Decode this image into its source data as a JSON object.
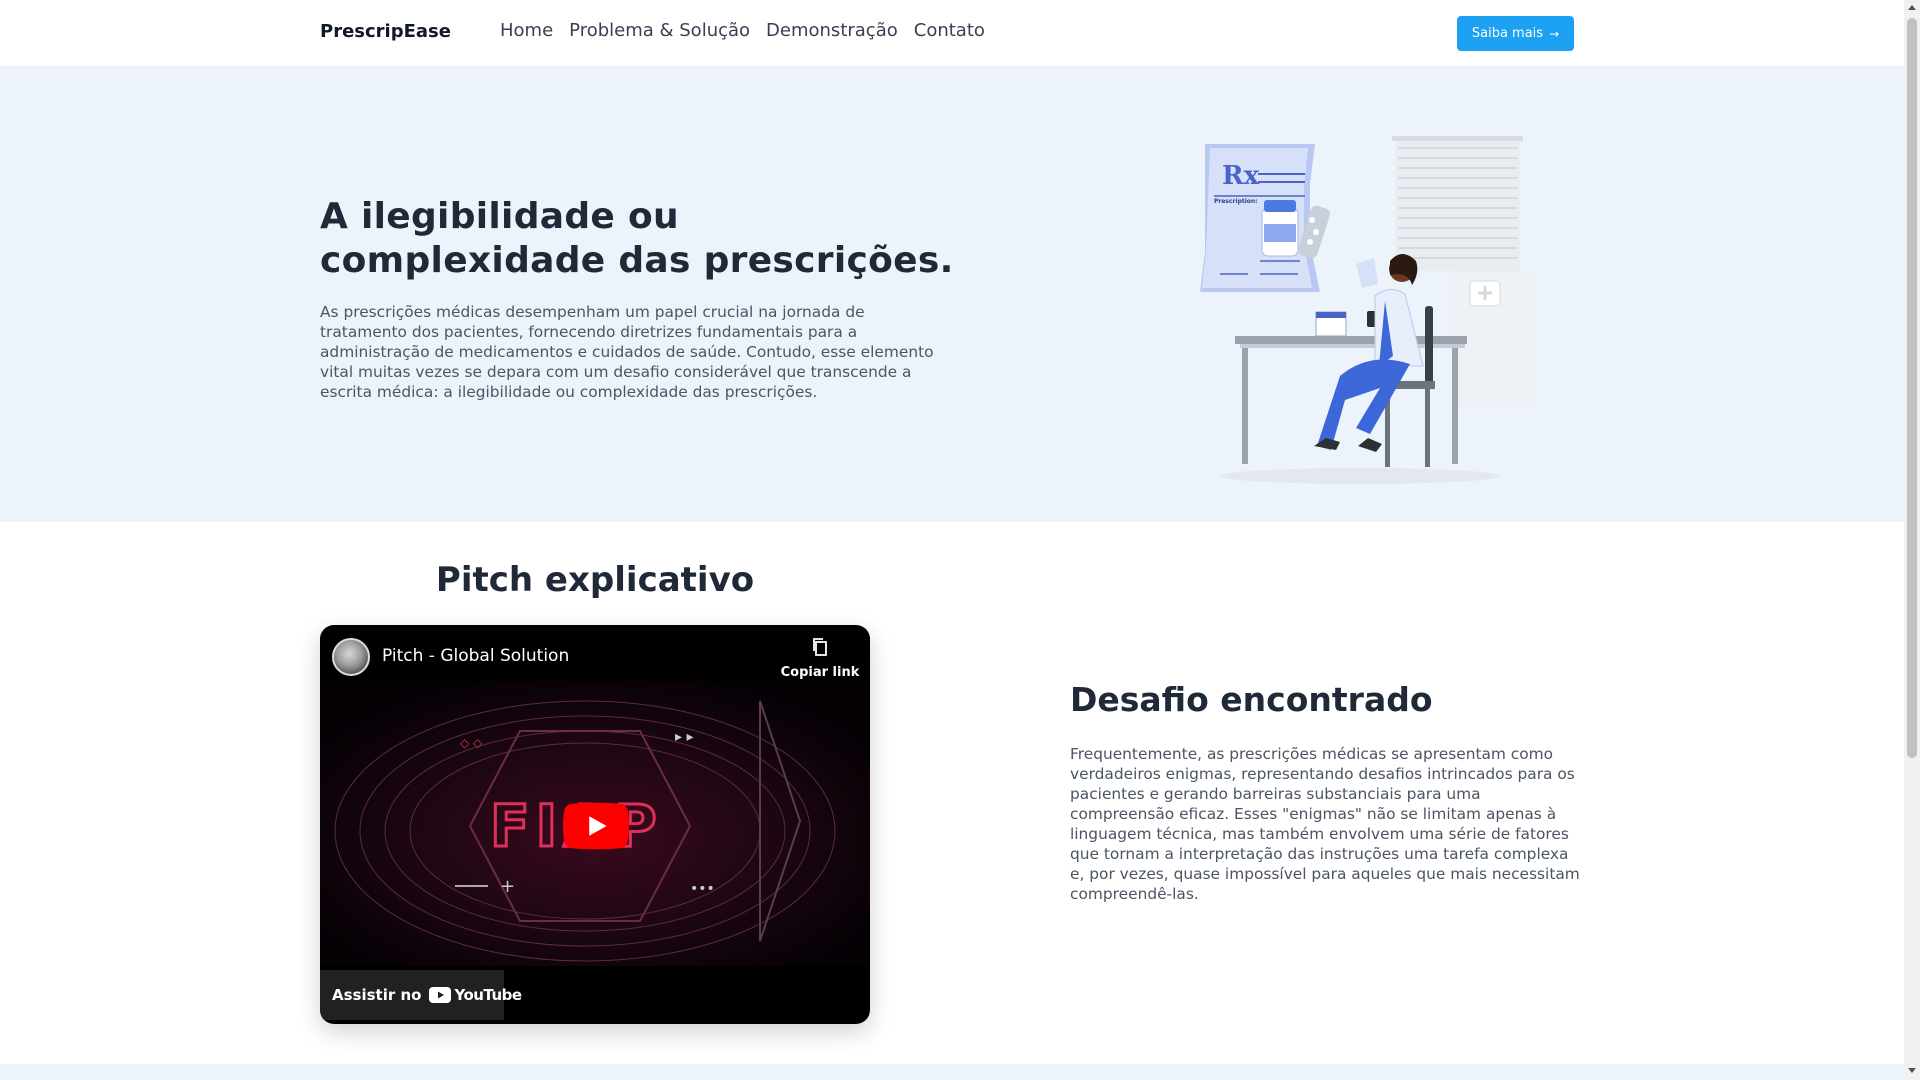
{
  "navbar": {
    "brand": "PrescripEase",
    "links": [
      "Home",
      "Problema & Solução",
      "Demonstração",
      "Contato"
    ],
    "cta_label": "Saiba mais",
    "cta_color": "#1da1f2"
  },
  "hero": {
    "title_line1": "A ilegibilidade ou",
    "title_line2": "complexidade das prescrições.",
    "text": "As prescrições médicas desempenham um papel crucial na jornada de tratamento dos pacientes, fornecendo diretrizes fundamentais para a administração de medicamentos e cuidados de saúde. Contudo, esse elemento vital muitas vezes se depara com um desafio considerável que transcende a escrita médica: a ilegibilidade ou complexidade das prescrições.",
    "background": "#edf3fb",
    "illustration": {
      "icon": "doctor-prescription-illustration",
      "rx_label": "Rx",
      "prescription_label": "Prescription:"
    }
  },
  "pitch": {
    "title": "Pitch explicativo",
    "video": {
      "title": "Pitch - Global Solution",
      "copy_link_label": "Copiar link",
      "watch_on_label": "Assistir no",
      "youtube_label": "YouTube",
      "logo_text": "FIAP"
    }
  },
  "challenge": {
    "title": "Desafio encontrado",
    "text": "Frequentemente, as prescrições médicas se apresentam como verdadeiros enigmas, representando desafios intrincados para os pacientes e gerando barreiras substanciais para uma compreensão eficaz. Esses \"enigmas\" não se limitam apenas à linguagem técnica, mas também envolvem uma série de fatores que tornam a interpretação das instruções uma tarefa complexa e, por vezes, quase impossível para aqueles que mais necessitam compreendê-las."
  }
}
